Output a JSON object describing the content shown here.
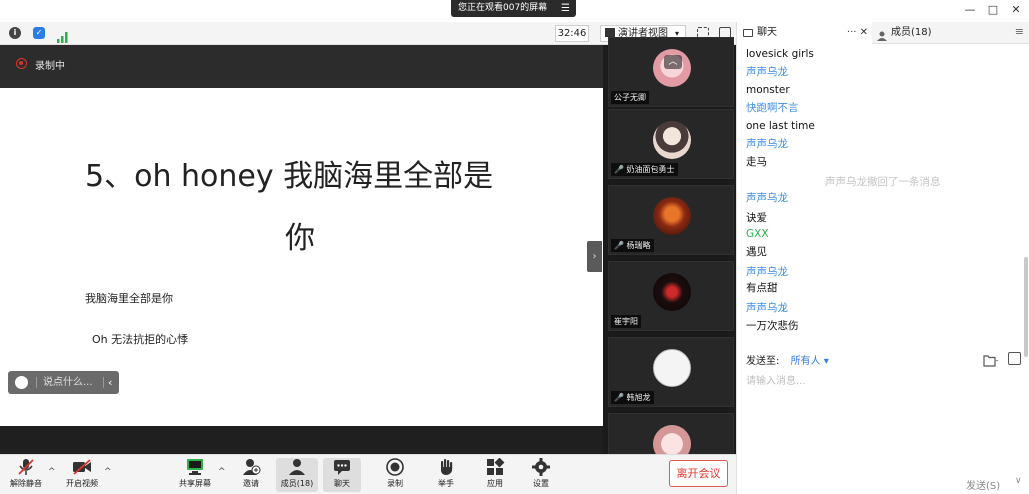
{
  "banner": {
    "text": "您正在观看007的屏幕",
    "menu_icon": "hamburger-icon"
  },
  "window": {
    "minimize": "—",
    "maximize": "□",
    "close": "✕"
  },
  "toolbar": {
    "timer": "32:46",
    "view_label": "演讲者视图",
    "view_caret": "▾"
  },
  "recording": {
    "label": "录制中"
  },
  "slide": {
    "title_line1": "5、oh honey 我脑海里全部是",
    "title_line2": "你",
    "line1": "我脑海里全部是你",
    "line2": "Oh 无法抗拒的心悸"
  },
  "comment": {
    "placeholder": "说点什么...",
    "chevron": "‹"
  },
  "participants": [
    {
      "name": "公子无卿",
      "avatar_color": "#e9a9b0"
    },
    {
      "name": "奶油面包勇士",
      "avatar_color": "#c9b4a8"
    },
    {
      "name": "杨瑞略",
      "avatar_color": "#b5421a"
    },
    {
      "name": "崔宇阳",
      "avatar_color": "#2a1a1a"
    },
    {
      "name": "韩旭龙",
      "avatar_color": "#f2f2f2"
    },
    {
      "name": "",
      "avatar_color": "#e8c2c4"
    }
  ],
  "controls": [
    {
      "label": "解除静音",
      "icon": "muted-mic-icon"
    },
    {
      "label": "开启视频",
      "icon": "video-off-icon"
    },
    {
      "label": "共享屏幕",
      "icon": "share-screen-icon"
    },
    {
      "label": "邀请",
      "icon": "invite-icon"
    },
    {
      "label": "成员(18)",
      "icon": "members-icon"
    },
    {
      "label": "聊天",
      "icon": "chat-icon"
    },
    {
      "label": "录制",
      "icon": "record-icon"
    },
    {
      "label": "举手",
      "icon": "raise-hand-icon"
    },
    {
      "label": "应用",
      "icon": "apps-icon"
    },
    {
      "label": "设置",
      "icon": "settings-icon"
    }
  ],
  "leave_label": "离开会议",
  "chat": {
    "tab_chat": "聊天",
    "tab_chat_controls": "··· ✕",
    "tab_members": "成员(18)",
    "messages": [
      {
        "kind": "text",
        "value": "lovesick girls"
      },
      {
        "kind": "sender",
        "value": "声声乌龙"
      },
      {
        "kind": "text",
        "value": "monster"
      },
      {
        "kind": "sender",
        "value": "快跑啊不言"
      },
      {
        "kind": "text",
        "value": "one last time"
      },
      {
        "kind": "sender",
        "value": "声声乌龙"
      },
      {
        "kind": "text",
        "value": "走马"
      },
      {
        "kind": "system",
        "value": "声声乌龙撤回了一条消息"
      },
      {
        "kind": "sender",
        "value": "声声乌龙"
      },
      {
        "kind": "text",
        "value": "诀爱"
      },
      {
        "kind": "sender",
        "value": "GXX"
      },
      {
        "kind": "text",
        "value": "遇见"
      },
      {
        "kind": "sender",
        "value": "声声乌龙"
      },
      {
        "kind": "text",
        "value": "有点甜"
      },
      {
        "kind": "sender",
        "value": "声声乌龙"
      },
      {
        "kind": "text",
        "value": "一万次悲伤"
      }
    ],
    "send_to_label": "发送至:",
    "send_to_value": "所有人 ▾",
    "input_placeholder": "请输入消息...",
    "send_label": "发送(S)",
    "send_caret": "∨",
    "colors": {
      "sender": "#3f8ee8",
      "sender_alt": "#29b24a",
      "system": "#c4c4c4"
    }
  }
}
